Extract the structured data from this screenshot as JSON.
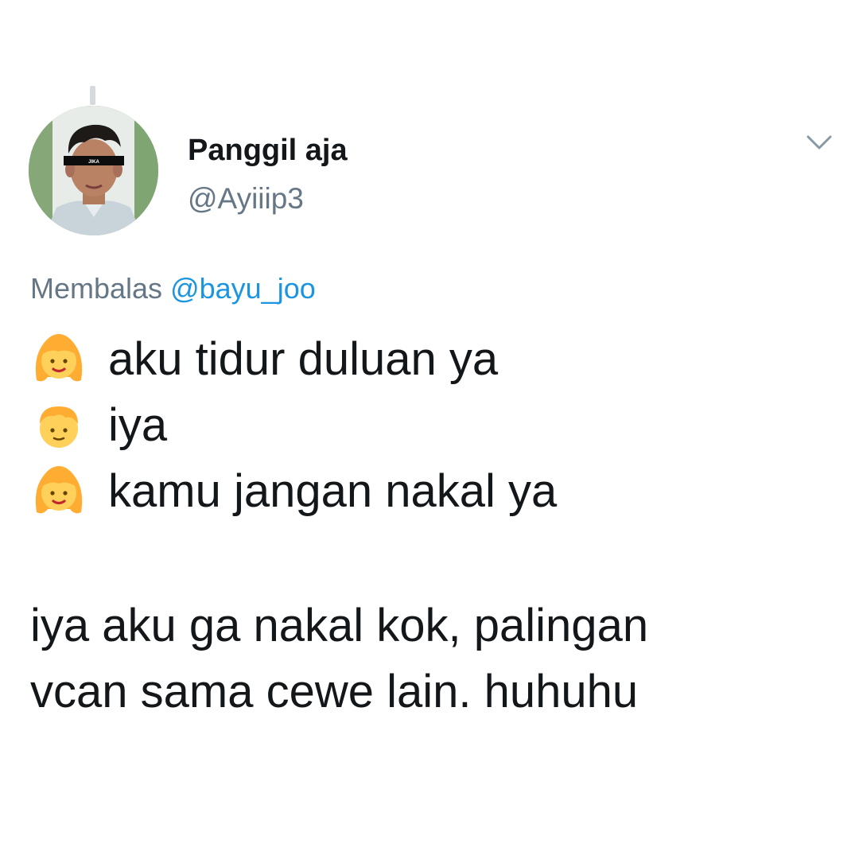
{
  "tweet": {
    "display_name": "Panggil aja",
    "handle": "@Ayiiip3",
    "avatar": {
      "description_icon": "user-avatar",
      "bar_text": "JIKA"
    },
    "reply": {
      "prefix": "Membalas ",
      "mention": "@bayu_joo"
    },
    "dialog": [
      {
        "emoji": "girl-emoji",
        "text": "aku tidur duluan ya"
      },
      {
        "emoji": "boy-emoji",
        "text": "iya"
      },
      {
        "emoji": "girl-emoji",
        "text": "kamu jangan nakal ya"
      }
    ],
    "body_lines": [
      "iya aku ga nakal kok, palingan",
      "vcan sama cewe lain. huhuhu"
    ]
  },
  "colors": {
    "text_primary": "#14171a",
    "text_secondary": "#657786",
    "link": "#1b95e0",
    "chevron": "#8899a6",
    "emoji_skin": "#ffd05a",
    "emoji_hair": "#ffac33"
  },
  "icons": {
    "menu": "chevron-down-icon"
  }
}
